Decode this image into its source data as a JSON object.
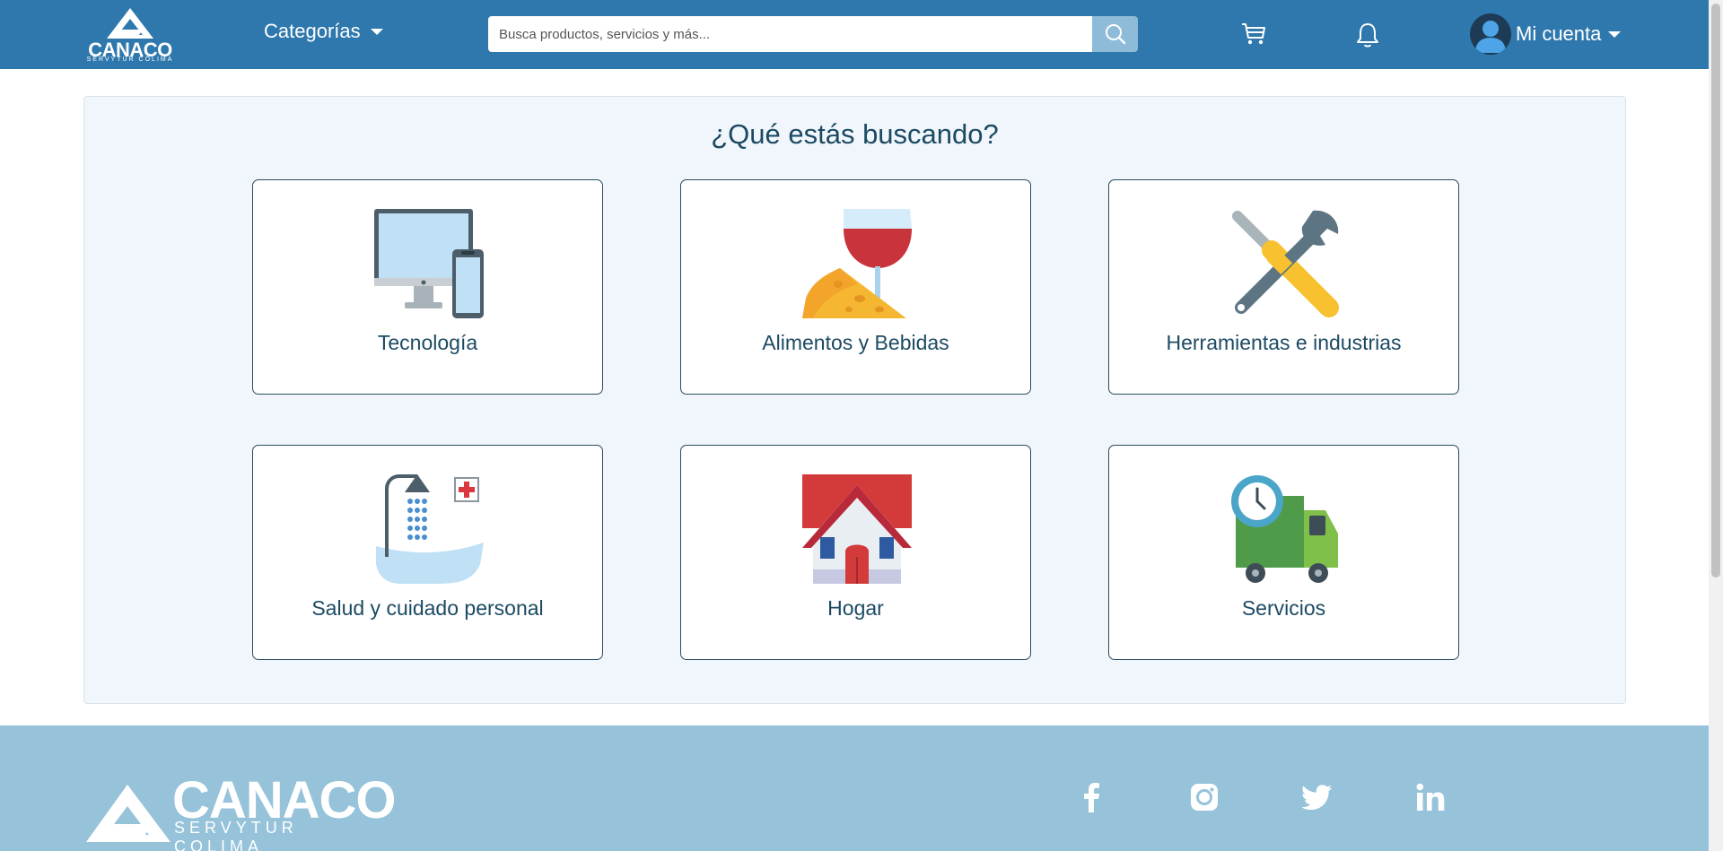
{
  "navbar": {
    "brand": "CANACO",
    "brand_sub": "SERVYTUR COLIMA",
    "categories_label": "Categorías",
    "search_placeholder": "Busca productos, servicios y más...",
    "search_value": "",
    "account_label": "Mi cuenta"
  },
  "main": {
    "title": "¿Qué estás buscando?",
    "categories": [
      {
        "label": "Tecnología",
        "icon": "computer-phone-icon"
      },
      {
        "label": "Alimentos y Bebidas",
        "icon": "wine-cheese-icon"
      },
      {
        "label": "Herramientas e industrias",
        "icon": "tools-icon"
      },
      {
        "label": "Salud y cuidado personal",
        "icon": "shower-health-icon"
      },
      {
        "label": "Hogar",
        "icon": "house-icon"
      },
      {
        "label": "Servicios",
        "icon": "delivery-truck-icon"
      }
    ]
  },
  "footer": {
    "brand": "CANACO",
    "brand_sub": "SERVYTUR COLIMA",
    "social": [
      "facebook-icon",
      "instagram-icon",
      "twitter-icon",
      "linkedin-icon"
    ]
  },
  "colors": {
    "navbar": "#2e78ad",
    "footer": "#96c3da",
    "panel": "#f0f6fb",
    "text": "#1c4a63"
  }
}
